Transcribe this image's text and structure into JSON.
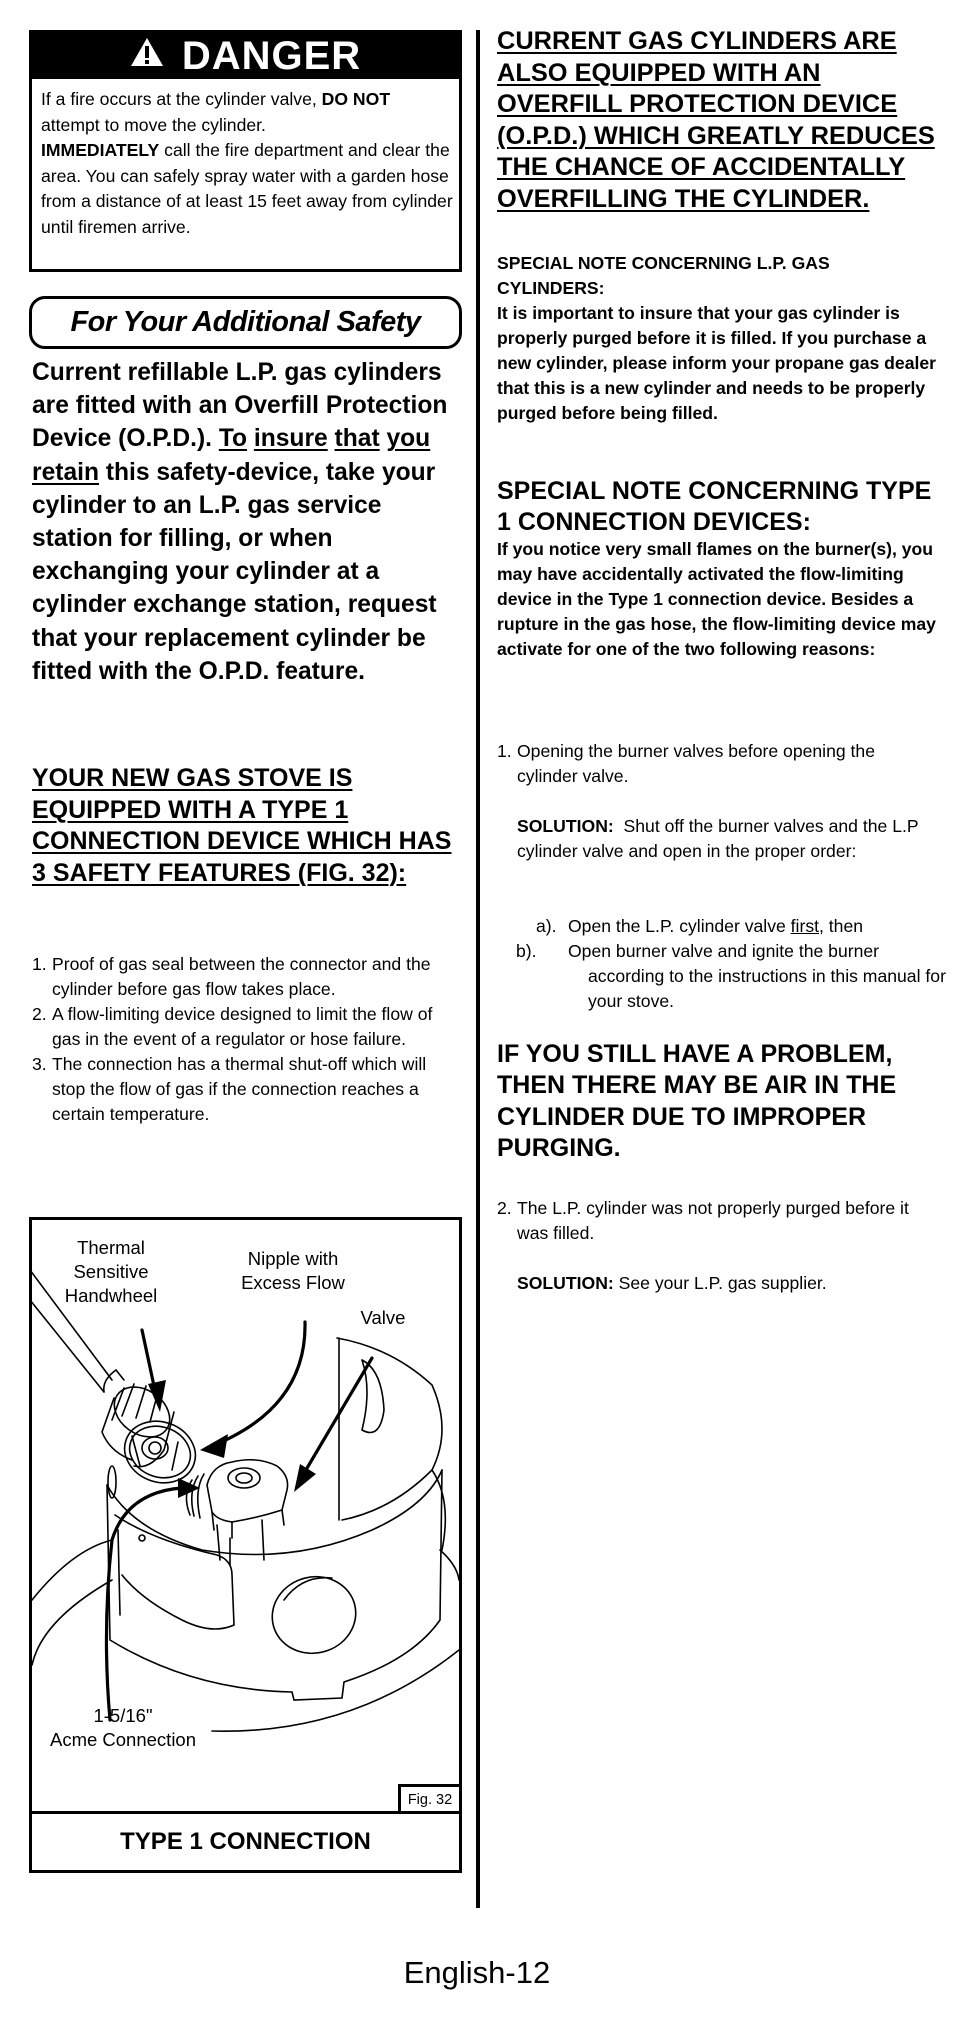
{
  "danger": {
    "icon": "warning-triangle-icon",
    "title": "DANGER",
    "body_segments": [
      {
        "t": "If a fire occurs at the cylinder valve, ",
        "b": false
      },
      {
        "t": "DO NOT",
        "b": true
      },
      {
        "t": " attempt to move the cylinder. ",
        "b": false
      },
      {
        "t": "IMMEDIATELY",
        "b": true
      },
      {
        "t": " call the fire department and clear the area.  You can safely spray water with a garden hose from a distance of at least 15 feet away from cylinder until firemen arrive.",
        "b": false
      }
    ]
  },
  "additional_safety": {
    "title": "For Your Additional Safety",
    "lead_part1": "Current refillable L.P. gas cylinders are fitted with an Overfill Protection Device (O.P.D.). ",
    "lead_underlined_words": [
      "To",
      "insure",
      "that",
      "you",
      "retain"
    ],
    "lead_part2": " this safety-device, take your cylinder to an L.P. gas service station for filling, or when exchanging your cylinder at a cylinder exchange station, request that your replacement cylinder be fitted with the O.P.D. feature."
  },
  "type1_heading": "YOUR NEW GAS STOVE IS EQUIPPED WITH A TYPE 1 CONNECTION DEVICE WHICH HAS 3 SAFETY FEATURES (FIG. 32):",
  "features": [
    {
      "num": "1.",
      "text": "Proof of gas seal between the connector and the cylinder before gas flow takes place."
    },
    {
      "num": "2.",
      "text": "A flow-limiting device designed to limit the flow of gas in the event of a regulator or hose failure."
    },
    {
      "num": "3.",
      "text": "The connection has a thermal shut-off which will stop the flow of gas if the connection reaches a certain temperature."
    }
  ],
  "figure": {
    "labels": {
      "handwheel_1": "Thermal",
      "handwheel_2": "Sensitive",
      "handwheel_3": "Handwheel",
      "nipple_1": "Nipple with",
      "nipple_2": "Excess Flow",
      "valve": "Valve",
      "acme_1": "1-5/16\"",
      "acme_2": "Acme Connection"
    },
    "fig_number": "Fig. 32",
    "caption": "TYPE 1 CONNECTION"
  },
  "right": {
    "opd_heading": "CURRENT GAS CYLINDERS ARE ALSO EQUIPPED WITH AN OVERFILL PROTECTION DEVICE (O.P.D.) WHICH GREATLY REDUCES THE CHANCE OF ACCIDENTALLY OVERFILLING THE CYLINDER.",
    "lp_note_heading": "SPECIAL NOTE CONCERNING L.P. GAS CYLINDERS:",
    "lp_note_body": "It is important to insure that your gas cylinder is properly purged before it is filled. If you purchase a new cylinder, please inform your propane gas dealer that this is a new cylinder and needs to be properly purged before being filled.",
    "type1_note_heading": "SPECIAL NOTE CONCERNING TYPE 1 CONNECTION DEVICES:",
    "type1_note_body": "If you notice very small flames on the burner(s), you may have accidentally activated the flow-limiting device in the Type 1 connection device. Besides a rupture in the gas hose, the flow-limiting device may activate for one of the two following reasons:",
    "reason1": {
      "num": "1.",
      "text": "Opening the burner valves before opening the cylinder valve."
    },
    "solution1_label": "SOLUTION:",
    "solution1_text": "  Shut off the burner valves and the L.P cylinder valve and open in the proper order:",
    "steps": [
      {
        "label": "a).",
        "pre": "Open the L.P. cylinder valve ",
        "underlined": "first",
        "post": ", then"
      },
      {
        "label": "b).",
        "pre": "Open burner valve and ignite the burner according to the instructions in this manual for your stove.",
        "underlined": "",
        "post": ""
      }
    ],
    "still_problem_heading": "IF YOU STILL HAVE A PROBLEM, THEN THERE MAY BE AIR IN THE CYLINDER DUE TO IMPROPER PURGING.",
    "reason2": {
      "num": "2.",
      "text": "The L.P. cylinder was not properly purged before it was filled."
    },
    "solution2_label": "SOLUTION:",
    "solution2_text": " See your L.P. gas supplier."
  },
  "footer": {
    "page_label": "English-12"
  }
}
